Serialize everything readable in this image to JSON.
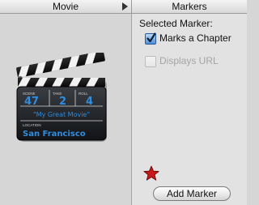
{
  "header": {
    "left_title": "Movie",
    "right_title": "Markers"
  },
  "movie_pane": {
    "clapperboard": {
      "scene_label": "SCENE",
      "take_label": "TAKE",
      "roll_label": "ROLL",
      "scene_value": "47",
      "take_value": "2",
      "roll_value": "4",
      "title_text": "\"My Great Movie\"",
      "location_label": "LOCATION",
      "location_value": "San Francisco"
    }
  },
  "markers_pane": {
    "selected_label": "Selected Marker:",
    "marks_chapter": {
      "label": "Marks a Chapter",
      "checked": true,
      "enabled": true
    },
    "displays_url": {
      "label": "Displays URL",
      "checked": false,
      "enabled": false
    },
    "add_button_label": "Add Marker"
  },
  "colors": {
    "chalk": "#2f8de0",
    "star": "#c81818",
    "checkbox_checked": "#4f8fd6"
  }
}
